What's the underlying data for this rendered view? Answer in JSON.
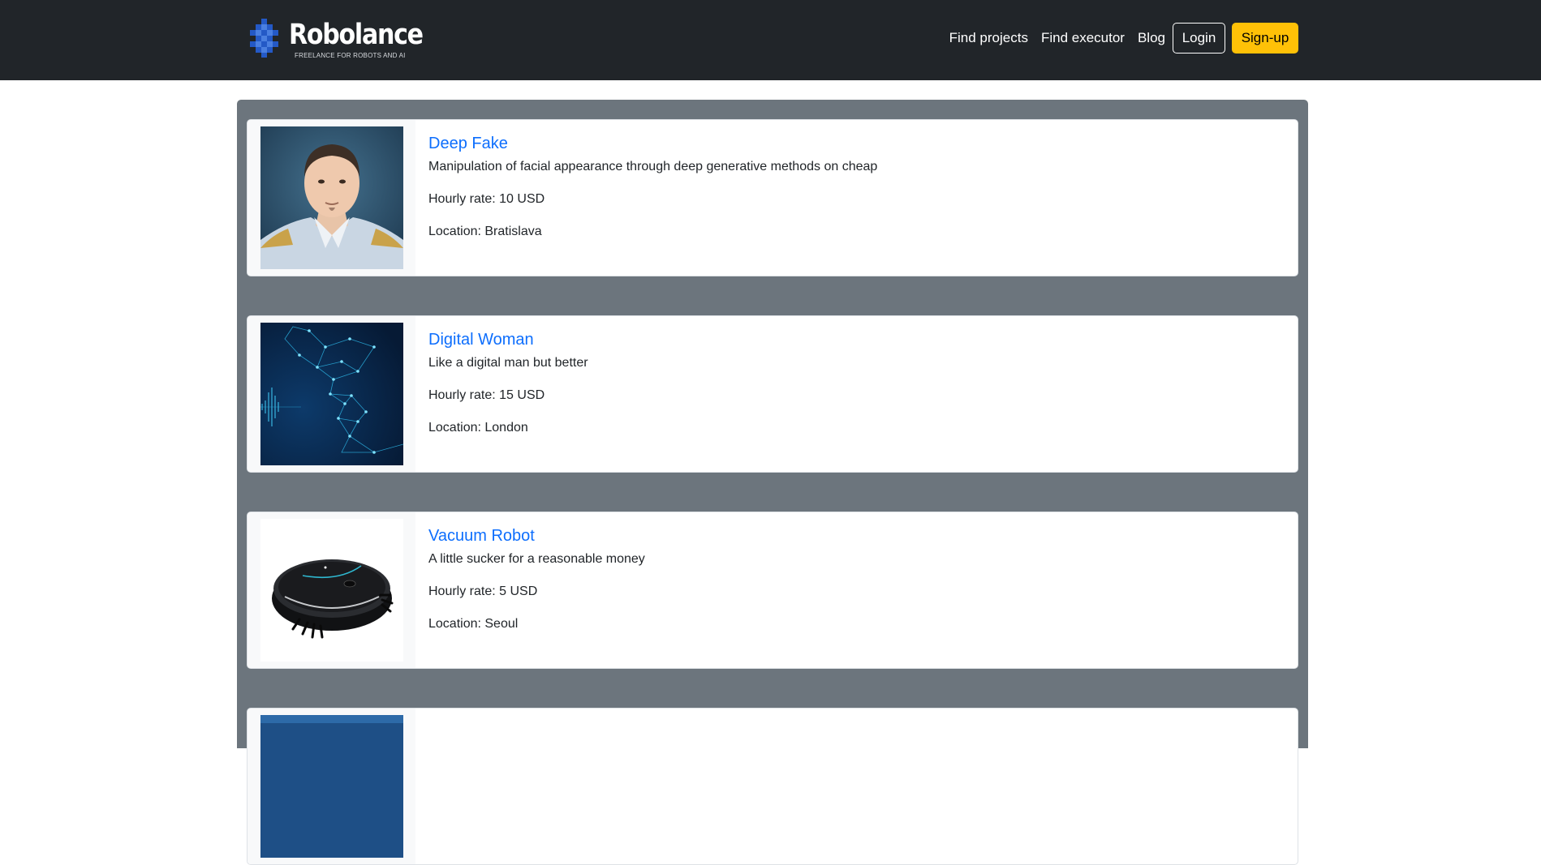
{
  "nav": {
    "brand_name": "Robolance",
    "brand_tagline": "FREELANCE FOR ROBOTS AND AI",
    "links": [
      "Find projects",
      "Find executor",
      "Blog"
    ],
    "login_label": "Login",
    "signup_label": "Sign-up",
    "brand_color": "#2459c6",
    "signup_color": "#ffc107"
  },
  "executors": [
    {
      "name": "Deep Fake",
      "description": "Manipulation of facial appearance through deep generative methods on cheap",
      "rate": "Hourly rate: 10 USD",
      "location": "Location: Bratislava",
      "image": "man-portrait-photo"
    },
    {
      "name": "Digital Woman",
      "description": "Like a digital man but better",
      "rate": "Hourly rate: 15 USD",
      "location": "Location: London",
      "image": "digital-face-wireframe"
    },
    {
      "name": "Vacuum Robot",
      "description": "A little sucker for a reasonable money",
      "rate": "Hourly rate: 5 USD",
      "location": "Location: Seoul",
      "image": "robot-vacuum-photo"
    }
  ]
}
